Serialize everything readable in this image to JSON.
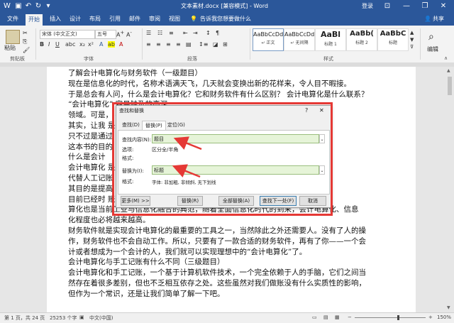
{
  "window": {
    "title": "文本素材.docx [兼容模式] - Word",
    "login": "登录",
    "minimize_icon": "—",
    "restore_icon": "❐",
    "close_icon": "✕"
  },
  "tabs": [
    "文件",
    "开始",
    "插入",
    "设计",
    "布局",
    "引用",
    "邮件",
    "审阅",
    "视图"
  ],
  "tell_me": "告诉我您想要做什么",
  "share": "共享",
  "ribbon": {
    "paste": "粘贴",
    "clipboard_group": "剪贴板",
    "font_name": "宋体 (中文正文)",
    "font_size": "五号",
    "font_group": "字体",
    "paragraph_group": "段落",
    "styles_group": "样式",
    "editing": "编辑",
    "styles": [
      {
        "preview": "AaBbCcDd",
        "label": "↵ 正文"
      },
      {
        "preview": "AaBbCcDd",
        "label": "↵ 无间隔"
      },
      {
        "preview": "AaBl",
        "label": "标题 1"
      },
      {
        "preview": "AaBb(",
        "label": "标题 2"
      },
      {
        "preview": "AaBbC",
        "label": "标题"
      }
    ]
  },
  "document_lines": [
    "了解会计电算化与财务软件（一级题目）",
    "现在是信息化的时代，名称术语满天飞，几天就会变换出新的花样来，令人目不暇接。",
    "于是总会有人问，什么是会计电算化？它和财务软件有什么区别？ 会计电算化是什么联系？",
    "“会计电算化”                                                                   容易触及的高深",
    "领域。可是，                                                                   要入门者。",
    "其实，让我                                                                     是“会计电算化”",
    "只不过是通过                                                                   ",
    "这本书的目的                                                                   高手。",
    "什么是会计",
    "会计电算化                                                                      是用电子计算机",
    "代替人工记账                                                                    、决策的过程，",
    "其目的是提高",
    "目前已经时                                                                      账而已。会计电",
    "算化也是当前工业与信息化融合的典范，随着全面信息化时代的到来，会计电算化、信息",
    "化程度也必将越来越高。",
    "财务软件就是实现会计电算化的最重要的工具之一，当然除此之外还需要人。没有了人的操",
    "作，财务软件也不会自动工作。所以，只要有了一款合适的财务软件，再有了你——一个会",
    "计或者想成为一个会计的人，我们就可以实现理想中的“会计电算化”了。",
    "会计电算化与手工记账有什么不同（三级题目）",
    "会计电算化和手工记账，一个基于计算机软件技术，一个完全依赖于人的手脑，它们之间当",
    "然存在着很多差别，但也不乏相互依存之处。这些虽然对我们做账没有什么实质性的影响，",
    "但作为一个常识，还是让我们简单了解一下吧。"
  ],
  "dialog": {
    "title": "查找和替换",
    "help": "?",
    "close": "✕",
    "tabs": [
      "查找(D)",
      "替换(P)",
      "定位(G)"
    ],
    "find_label": "查找内容(N):",
    "find_value": "题目",
    "options_label": "选项:",
    "options_value": "区分全/半角",
    "format_label": "格式:",
    "replace_label": "替换为(I):",
    "replace_value": "标题",
    "replace_format_label": "格式:",
    "replace_format_value": "字体: 非加粗, 非倾斜, 无下划线",
    "buttons": {
      "more": "更多(M) >>",
      "replace": "替换(R)",
      "replace_all": "全部替换(A)",
      "find_next": "查找下一处(F)",
      "cancel": "取消"
    }
  },
  "status": {
    "page": "第 1 页，共 24 页",
    "words": "25253 个字",
    "language": "中文(中国)",
    "zoom": "150%"
  },
  "colors": {
    "brand": "#2b579a",
    "highlight": "#e53935",
    "field_bg": "#e6f4d8"
  }
}
